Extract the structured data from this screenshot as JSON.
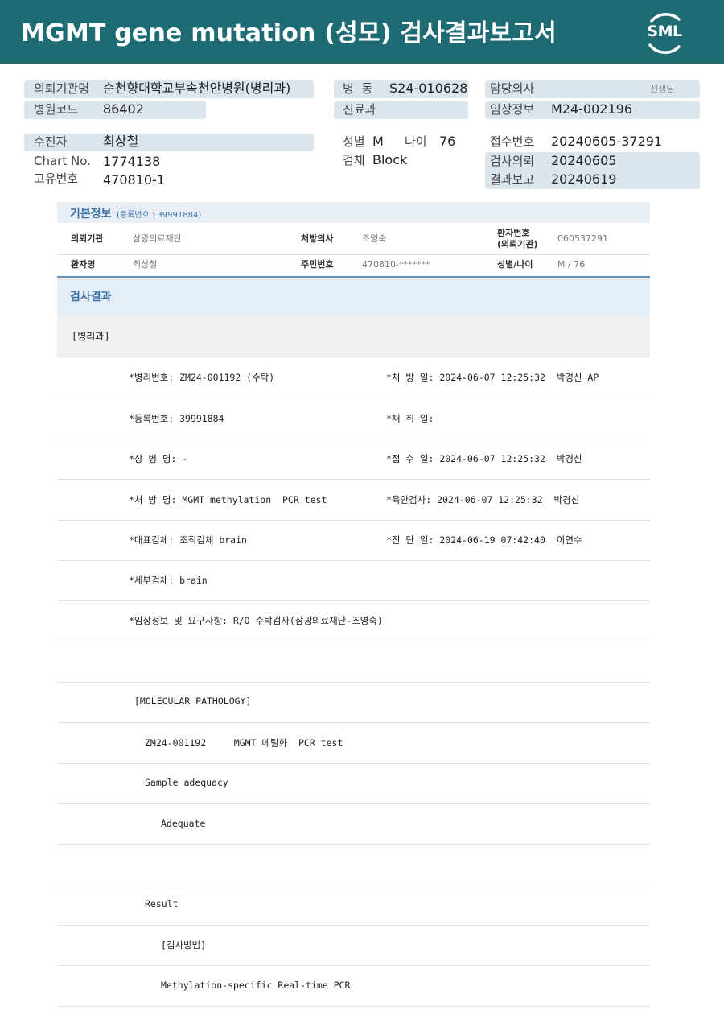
{
  "header": {
    "title": "MGMT gene mutation (성모) 검사결과보고서",
    "logo": "SML"
  },
  "info": {
    "requester_label": "의뢰기관명",
    "requester_value": "순천향대학교부속천안병원(병리과)",
    "hospital_code_label": "병원코드",
    "hospital_code_value": "86402",
    "ward_label": "병  동",
    "ward_value": "S24-010628",
    "dept_label": "진료과",
    "doctor_label": "담당의사",
    "doctor_suffix": "선생님",
    "clinical_label": "임상정보",
    "clinical_value": "M24-002196",
    "patient_label": "수진자",
    "patient_value": "최상철",
    "chart_label": "Chart No.",
    "chart_value": "1774138",
    "unique_label": "고유번호",
    "unique_value": "470810-1",
    "sex_label": "성별",
    "sex_value": "M",
    "age_label": "나이",
    "age_value": "76",
    "specimen_label": "검체",
    "specimen_value": "Block",
    "receipt_label": "접수번호",
    "receipt_value": "20240605-37291",
    "request_label": "검사의뢰",
    "request_value": "20240605",
    "report_label": "결과보고",
    "report_value": "20240619"
  },
  "basic": {
    "title": "기본정보",
    "reg_no": "(등록번호 : 39991884)",
    "r1": {
      "org_label": "의뢰기관",
      "org_value": "삼광의료재단",
      "doc_label": "처방의사",
      "doc_value": "조영숙",
      "pt_no_label_1": "환자번호",
      "pt_no_label_2": "(의뢰기관)",
      "pt_no_value": "060537291"
    },
    "r2": {
      "name_label": "환자명",
      "name_value": "최상철",
      "id_label": "주민번호",
      "id_value": "470810-*******",
      "sexage_label": "성별/나이",
      "sexage_value": "M / 76"
    }
  },
  "results": {
    "title": "검사결과",
    "dept": "[병리과]",
    "rows": [
      {
        "left": "*병리번호: ZM24-001192 (수탁)",
        "right": "*처 방 일: 2024-06-07 12:25:32  박경신 AP"
      },
      {
        "left": "*등록번호: 39991884",
        "right": "*채 취 일:"
      },
      {
        "left": "*상 병 명: -",
        "right": "*접 수 일: 2024-06-07 12:25:32  박경신"
      },
      {
        "left": "*처 방 명: MGMT methylation  PCR test",
        "right": "*육안검사: 2024-06-07 12:25:32  박경신"
      },
      {
        "left": "*대표검체: 조직검체 brain",
        "right": "*진 단 일: 2024-06-19 07:42:40  이연수"
      },
      {
        "left": "*세부검체: brain",
        "right": ""
      },
      {
        "left": "*임상정보 및 요구사항: R/O 수탁검사(삼광의료재단-조영숙)",
        "right": ""
      }
    ],
    "molecular": "[MOLECULAR PATHOLOGY]",
    "test_line": "ZM24-001192     MGMT 메틸화  PCR test",
    "sample_adequacy": "Sample adequacy",
    "adequate": "Adequate",
    "result": "Result",
    "method_label": "[검사방법]",
    "method": "Methylation-specific Real-time PCR"
  }
}
